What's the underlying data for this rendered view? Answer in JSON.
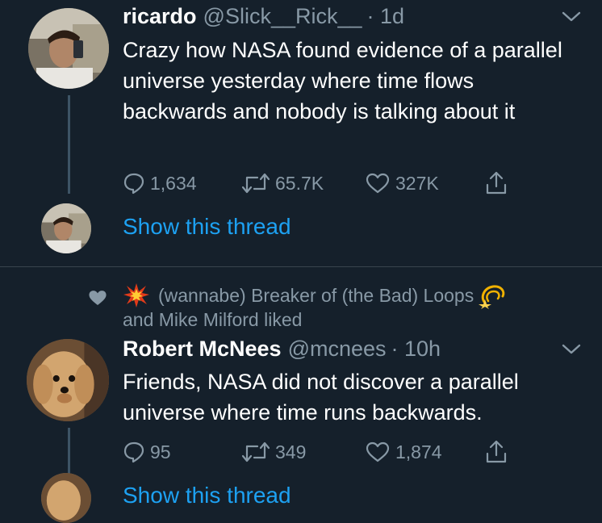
{
  "tweet1": {
    "name": "ricardo",
    "handle": "@Slick__Rick__",
    "time": "· 1d",
    "text": "Crazy how NASA found evidence of a parallel universe yesterday where time flows backwards and nobody is talking about it",
    "replies": "1,634",
    "retweets": "65.7K",
    "likes": "327K",
    "show_thread": "Show this thread"
  },
  "liked_by": {
    "line1": "(wannabe) Breaker of (the Bad) Loops",
    "line2": "and Mike Milford liked"
  },
  "tweet2": {
    "name": "Robert McNees",
    "handle": "@mcnees",
    "time": "· 10h",
    "text": "Friends, NASA did not discover a parallel universe where time runs backwards.",
    "replies": "95",
    "retweets": "349",
    "likes": "1,874",
    "show_thread": "Show this thread"
  },
  "icons": {
    "reply": "reply-icon",
    "retweet": "retweet-icon",
    "like": "heart-icon",
    "share": "share-icon",
    "caret": "chevron-down-icon",
    "explosion": "explosion-emoji-icon",
    "dizzy": "dizzy-emoji-icon"
  },
  "colors": {
    "background": "#15202b",
    "text": "#ffffff",
    "muted": "#8899a6",
    "link": "#1da1f2",
    "divider": "#38444d"
  }
}
